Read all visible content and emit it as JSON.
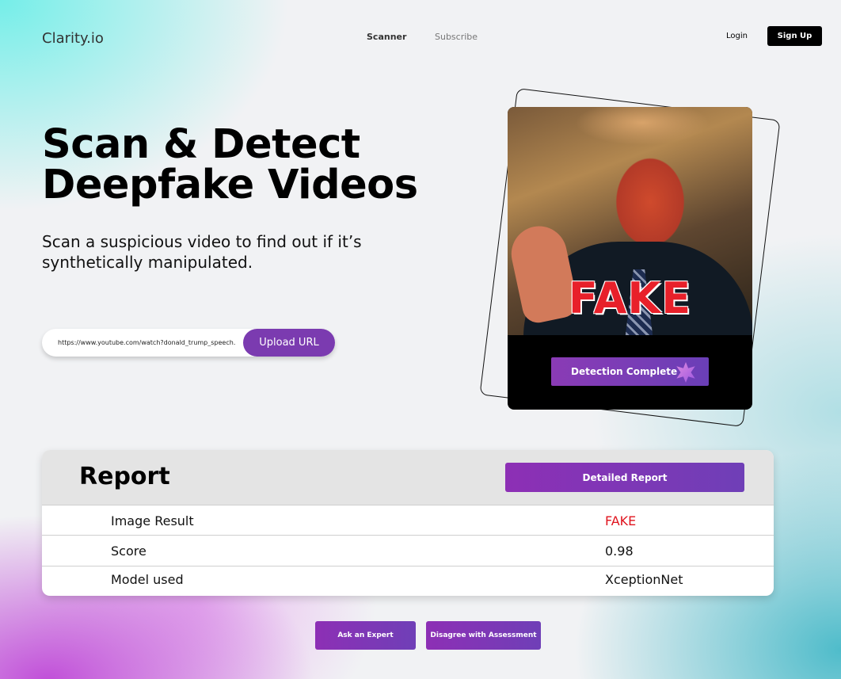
{
  "header": {
    "brand": "Clarity.io",
    "nav": [
      "Scanner",
      "Subscribe"
    ],
    "login": "Login",
    "signup": "Sign Up"
  },
  "hero": {
    "title": "Scan & Detect\nDeepfake Videos",
    "subtitle": "Scan a suspicious video to find out if it’s synthetically manipulated.",
    "url_value": "https://www.youtube.com/watch?donald_trump_speech.",
    "upload_label": "Upload URL"
  },
  "preview": {
    "stamp": "FAKE",
    "status_button": "Detection Complete",
    "icon": "sparkle-icon"
  },
  "report": {
    "title": "Report",
    "detail_button": "Detailed Report",
    "rows": [
      {
        "label": "Image Result",
        "value": "FAKE"
      },
      {
        "label": "Score",
        "value": "0.98"
      },
      {
        "label": "Model used",
        "value": "XceptionNet"
      }
    ]
  },
  "actions": {
    "ask_expert": "Ask an Expert",
    "disagree": "Disagree with Assessment"
  },
  "colors": {
    "accent": "#7b3bb0",
    "fake": "#e0141e"
  }
}
